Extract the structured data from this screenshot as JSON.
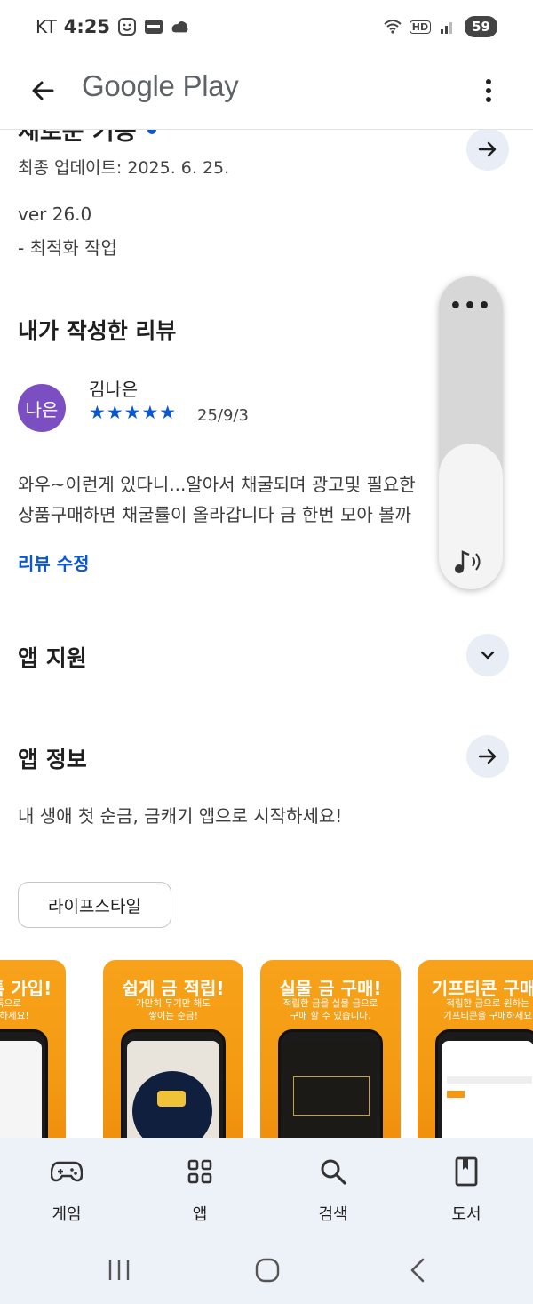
{
  "status_bar": {
    "carrier": "KT",
    "time": "4:25",
    "battery": "59"
  },
  "app_bar": {
    "title": "Google Play"
  },
  "whats_new": {
    "heading": "새로운 기능",
    "updated": "최종 업데이트: 2025. 6. 25.",
    "version": "ver 26.0",
    "note": "- 최적화 작업"
  },
  "my_review": {
    "title": "내가 작성한 리뷰",
    "avatar_text": "나은",
    "reviewer": "김나은",
    "stars": "★★★★★",
    "rating": 5,
    "date": "25/9/3",
    "text_line1": "와우~이런게 있다니...알아서 채굴되며 광고및 필요한",
    "text_line2": "상품구매하면 채굴률이 올라갑니다 금 한번 모아 볼까",
    "edit_label": "리뷰 수정"
  },
  "app_support": {
    "title": "앱 지원"
  },
  "app_info": {
    "title": "앱 정보",
    "description": "내 생애 첫 순금, 금캐기 앱으로 시작하세요!",
    "category_chip": "라이프스타일"
  },
  "screenshots": [
    {
      "title": "카카오톡 가입!",
      "subtitle": "카카오톡으로\n쉽게 시작하세요!"
    },
    {
      "title": "쉽게 금 적립!",
      "subtitle": "가만히 두기만 해도\n쌓이는 순금!"
    },
    {
      "title": "실물 금 구매!",
      "subtitle": "적립한 금을 실물 금으로\n구매 할 수 있습니다."
    },
    {
      "title": "기프티콘 구매!",
      "subtitle": "적립한 금으로 원하는\n기프티콘을 구매하세요"
    }
  ],
  "volume": {
    "level": 0.33
  },
  "bottom_nav": [
    {
      "label": "게임",
      "icon": "gamepad-icon"
    },
    {
      "label": "앱",
      "icon": "apps-grid-icon"
    },
    {
      "label": "검색",
      "icon": "search-icon"
    },
    {
      "label": "도서",
      "icon": "book-icon"
    }
  ],
  "colors": {
    "accent": "#0b57d0",
    "avatar": "#7b4fc2",
    "screenshot_orange": "#f39a12",
    "nav_bg": "#edf1f8"
  }
}
